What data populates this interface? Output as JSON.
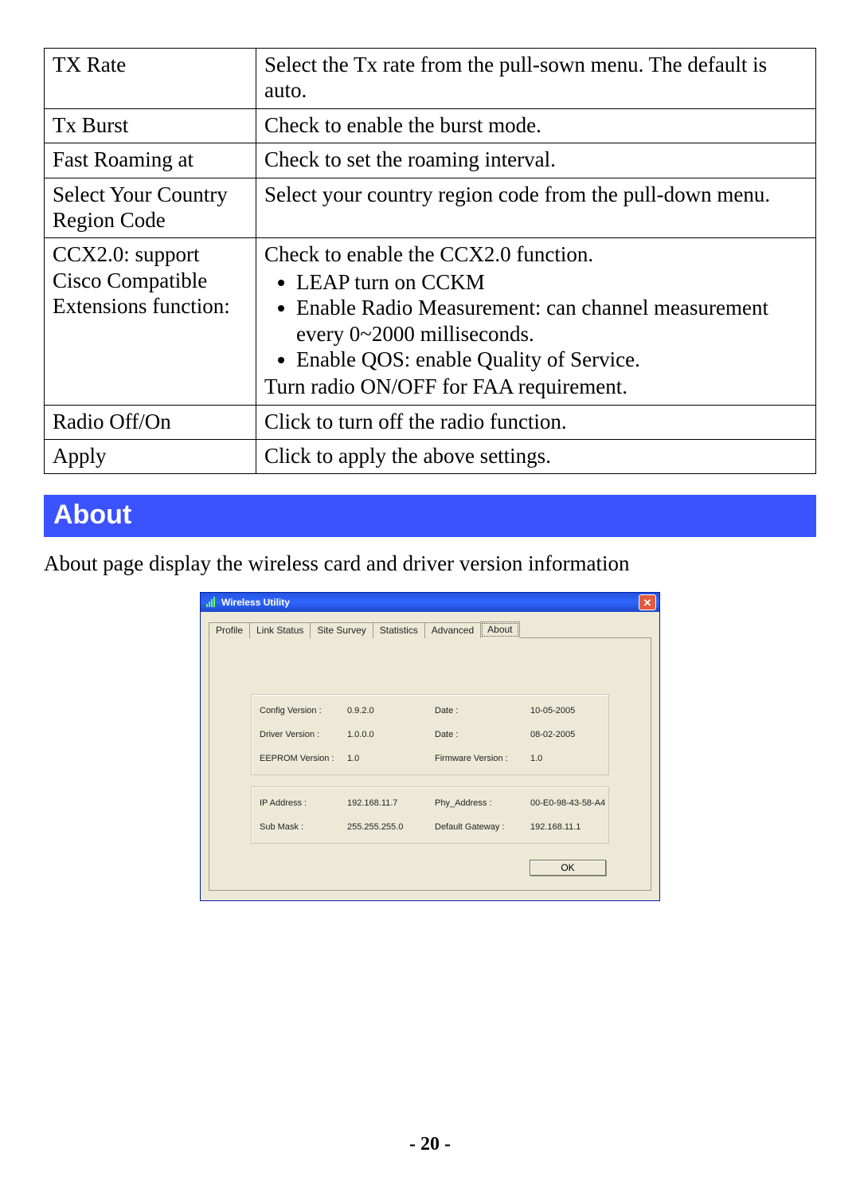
{
  "settings_table": {
    "rows": [
      {
        "key": "TX Rate",
        "desc": "Select the Tx rate from the pull-sown menu. The default is auto."
      },
      {
        "key": "Tx Burst",
        "desc": "Check to enable the burst mode."
      },
      {
        "key": "Fast Roaming at",
        "desc": "Check to set the roaming interval."
      },
      {
        "key": "Select Your Country Region Code",
        "desc": "Select your country region code from the pull-down menu."
      },
      {
        "key": "CCX2.0: support Cisco Compatible Extensions function:",
        "desc_lead": "Check to enable the CCX2.0 function.",
        "bullets": [
          "LEAP turn on CCKM",
          "Enable Radio Measurement: can channel measurement every 0~2000 milliseconds.",
          "Enable QOS: enable Quality of Service."
        ],
        "desc_trail": "Turn radio ON/OFF for FAA requirement."
      },
      {
        "key": "Radio Off/On",
        "desc": "Click to turn off the radio function."
      },
      {
        "key": "Apply",
        "desc": "Click to apply the above settings."
      }
    ]
  },
  "section": {
    "heading": "About",
    "intro": "About page display the wireless card and driver version information"
  },
  "dialog": {
    "title": "Wireless Utility",
    "close_glyph": "✕",
    "tabs": [
      "Profile",
      "Link Status",
      "Site Survey",
      "Statistics",
      "Advanced",
      "About"
    ],
    "active_tab": "About",
    "group1": [
      {
        "l1": "Config Version :",
        "v1": "0.9.2.0",
        "l2": "Date :",
        "v2": "10-05-2005"
      },
      {
        "l1": "Driver Version :",
        "v1": "1.0.0.0",
        "l2": "Date :",
        "v2": "08-02-2005"
      },
      {
        "l1": "EEPROM Version :",
        "v1": "1.0",
        "l2": "Firmware Version :",
        "v2": "1.0"
      }
    ],
    "group2": [
      {
        "l1": "IP Address :",
        "v1": "192.168.11.7",
        "l2": "Phy_Address :",
        "v2": "00-E0-98-43-58-A4"
      },
      {
        "l1": "Sub Mask :",
        "v1": "255.255.255.0",
        "l2": "Default Gateway :",
        "v2": "192.168.11.1"
      }
    ],
    "ok_label": "OK"
  },
  "page_number": "- 20 -"
}
